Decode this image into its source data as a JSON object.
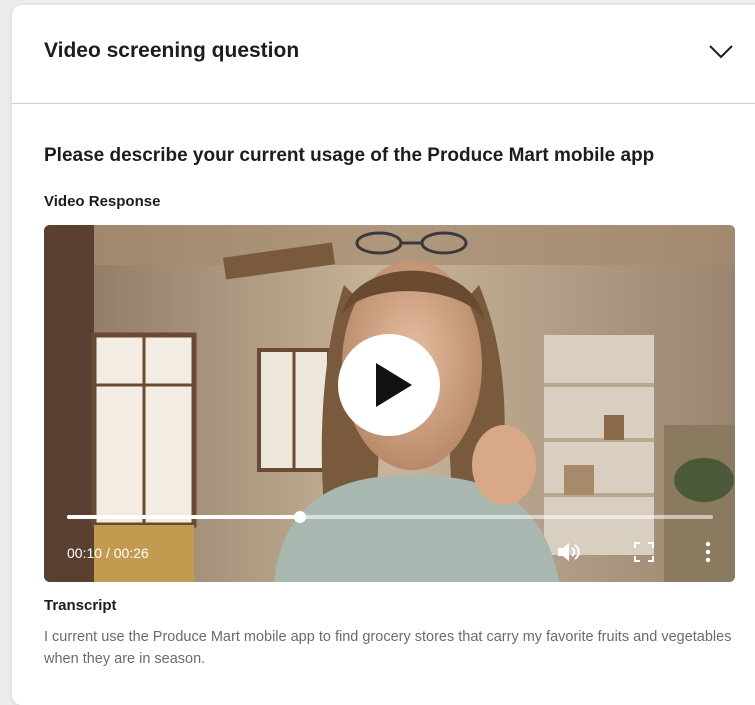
{
  "header": {
    "title": "Video screening question",
    "toggle_icon": "chevron-down-icon"
  },
  "question": {
    "text": "Please describe your current usage of the Produce Mart mobile app"
  },
  "video": {
    "label": "Video Response",
    "current_time": "00:10",
    "separator": "/",
    "duration": "00:26",
    "progress": 0.36,
    "icons": [
      "play-icon",
      "volume-icon",
      "fullscreen-icon",
      "more-options-icon"
    ]
  },
  "transcript": {
    "label": "Transcript",
    "text": "I current use the Produce Mart mobile app to find grocery stores that carry my favorite fruits and vegetables when they are in season."
  }
}
